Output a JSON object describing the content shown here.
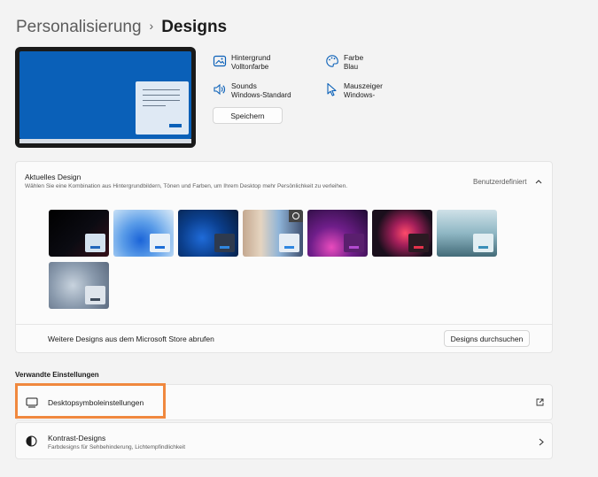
{
  "header": {
    "breadcrumb_parent": "Personalisierung",
    "breadcrumb_separator": "›",
    "title": "Designs"
  },
  "properties": {
    "background": {
      "label": "Hintergrund",
      "value": "Volltonfarbe",
      "icon": "picture-icon"
    },
    "color": {
      "label": "Farbe",
      "value": "Blau",
      "icon": "palette-icon"
    },
    "sounds": {
      "label": "Sounds",
      "value": "Windows-Standard",
      "icon": "speaker-icon"
    },
    "cursor": {
      "label": "Mauszeiger",
      "value": "Windows-",
      "icon": "mouse-pointer-icon"
    }
  },
  "save_label": "Speichern",
  "current_theme": {
    "title": "Aktuelles Design",
    "description": "Wählen Sie eine Kombination aus Hintergrundbildern, Tönen und Farben, um Ihrem Desktop mehr Persönlichkeit zu verleihen.",
    "value": "Benutzerdefiniert",
    "themes": [
      {
        "bg": "linear-gradient(135deg,#000 0%,#0b0b12 55%,#35101a 100%)",
        "mini": "#d4e2ef",
        "bar": "#2266bb"
      },
      {
        "bg": "radial-gradient(circle at 45% 65%,#1b64d8 0%,#5a9ce8 40%,#a8cdf2 75%,#dceaf7 100%)",
        "mini": "#e9f1f8",
        "bar": "#1d6ed6"
      },
      {
        "bg": "radial-gradient(circle at 40% 60%,#1f6bd9 0%,#0b3f8d 45%,#071b3a 100%)",
        "mini": "#2e3a4e",
        "bar": "#2f86e0"
      },
      {
        "bg": "linear-gradient(90deg,#c4a890 0%,#e5d4c0 30%,#8fb4d8 60%,#405070 100%)",
        "mini": "#e6edf5",
        "bar": "#2f86e0"
      },
      {
        "bg": "radial-gradient(circle at 40% 80%,#e94bbd 0%,#6f1e8a 40%,#1f0b33 100%)",
        "mini": "#5a1f6e",
        "bar": "#b24ad0"
      },
      {
        "bg": "radial-gradient(circle at 55% 50%,#ff4a6a 0%,#a31f5a 30%,#1a0f1c 70%)",
        "mini": "#2b1a22",
        "bar": "#e4324a"
      },
      {
        "bg": "linear-gradient(180deg,#cfe1e8 0%,#8fb7c4 50%,#436b78 100%)",
        "mini": "#e2eef2",
        "bar": "#3a8fb8"
      },
      {
        "bg": "radial-gradient(circle at 40% 50%,#c8d3de 0%,#8a9aad 50%,#5c6b80 100%)",
        "mini": "#dfe5ec",
        "bar": "#3e4b5a"
      }
    ]
  },
  "store": {
    "text": "Weitere Designs aus dem Microsoft Store abrufen",
    "button": "Designs durchsuchen"
  },
  "related": {
    "heading": "Verwandte Einstellungen"
  },
  "desktop_icons": {
    "label": "Desktopsymboleinstellungen",
    "icon": "monitor-icon",
    "action_icon": "external-link-icon"
  },
  "contrast": {
    "title": "Kontrast-Designs",
    "subtitle": "Farbdesigns für Sehbehinderung, Lichtempfindlichkeit",
    "icon": "contrast-icon"
  },
  "accent": "#0a60b8",
  "highlight": "#f0883e"
}
